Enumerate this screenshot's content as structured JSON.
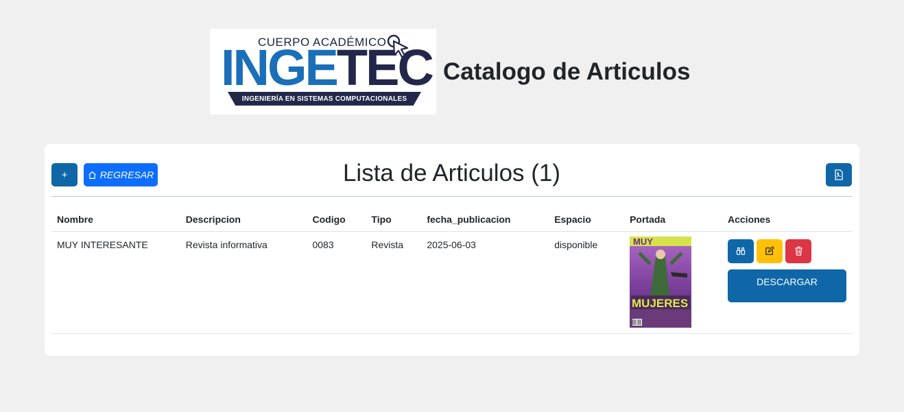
{
  "logo": {
    "top_text": "CUERPO ACADÉMICO",
    "main_ing": "INGE",
    "main_tec": "TEC",
    "subtitle": "INGENIERÍA EN SISTEMAS COMPUTACIONALES"
  },
  "page_title": "Catalogo de Articulos",
  "toolbar": {
    "add_label": "+",
    "back_label": "REGRESAR",
    "list_title": "Lista de Articulos (1)"
  },
  "table": {
    "headers": [
      "Nombre",
      "Descripcion",
      "Codigo",
      "Tipo",
      "fecha_publicacion",
      "Espacio",
      "Portada",
      "Acciones"
    ],
    "rows": [
      {
        "nombre": "MUY INTERESANTE",
        "descripcion": "Revista informativa",
        "codigo": "0083",
        "tipo": "Revista",
        "fecha_publicacion": "2025-06-03",
        "espacio": "disponible",
        "portada_text": "MUJERES",
        "download_label": "DESCARGAR"
      }
    ]
  },
  "colors": {
    "primary": "#0f67a8",
    "back_button": "#0d6efd",
    "edit": "#ffc107",
    "delete": "#dc3545",
    "background": "#f0f0f0"
  },
  "icons": [
    "home-icon",
    "pdf-icon",
    "binoculars-icon",
    "edit-icon",
    "trash-icon",
    "cursor-icon"
  ]
}
